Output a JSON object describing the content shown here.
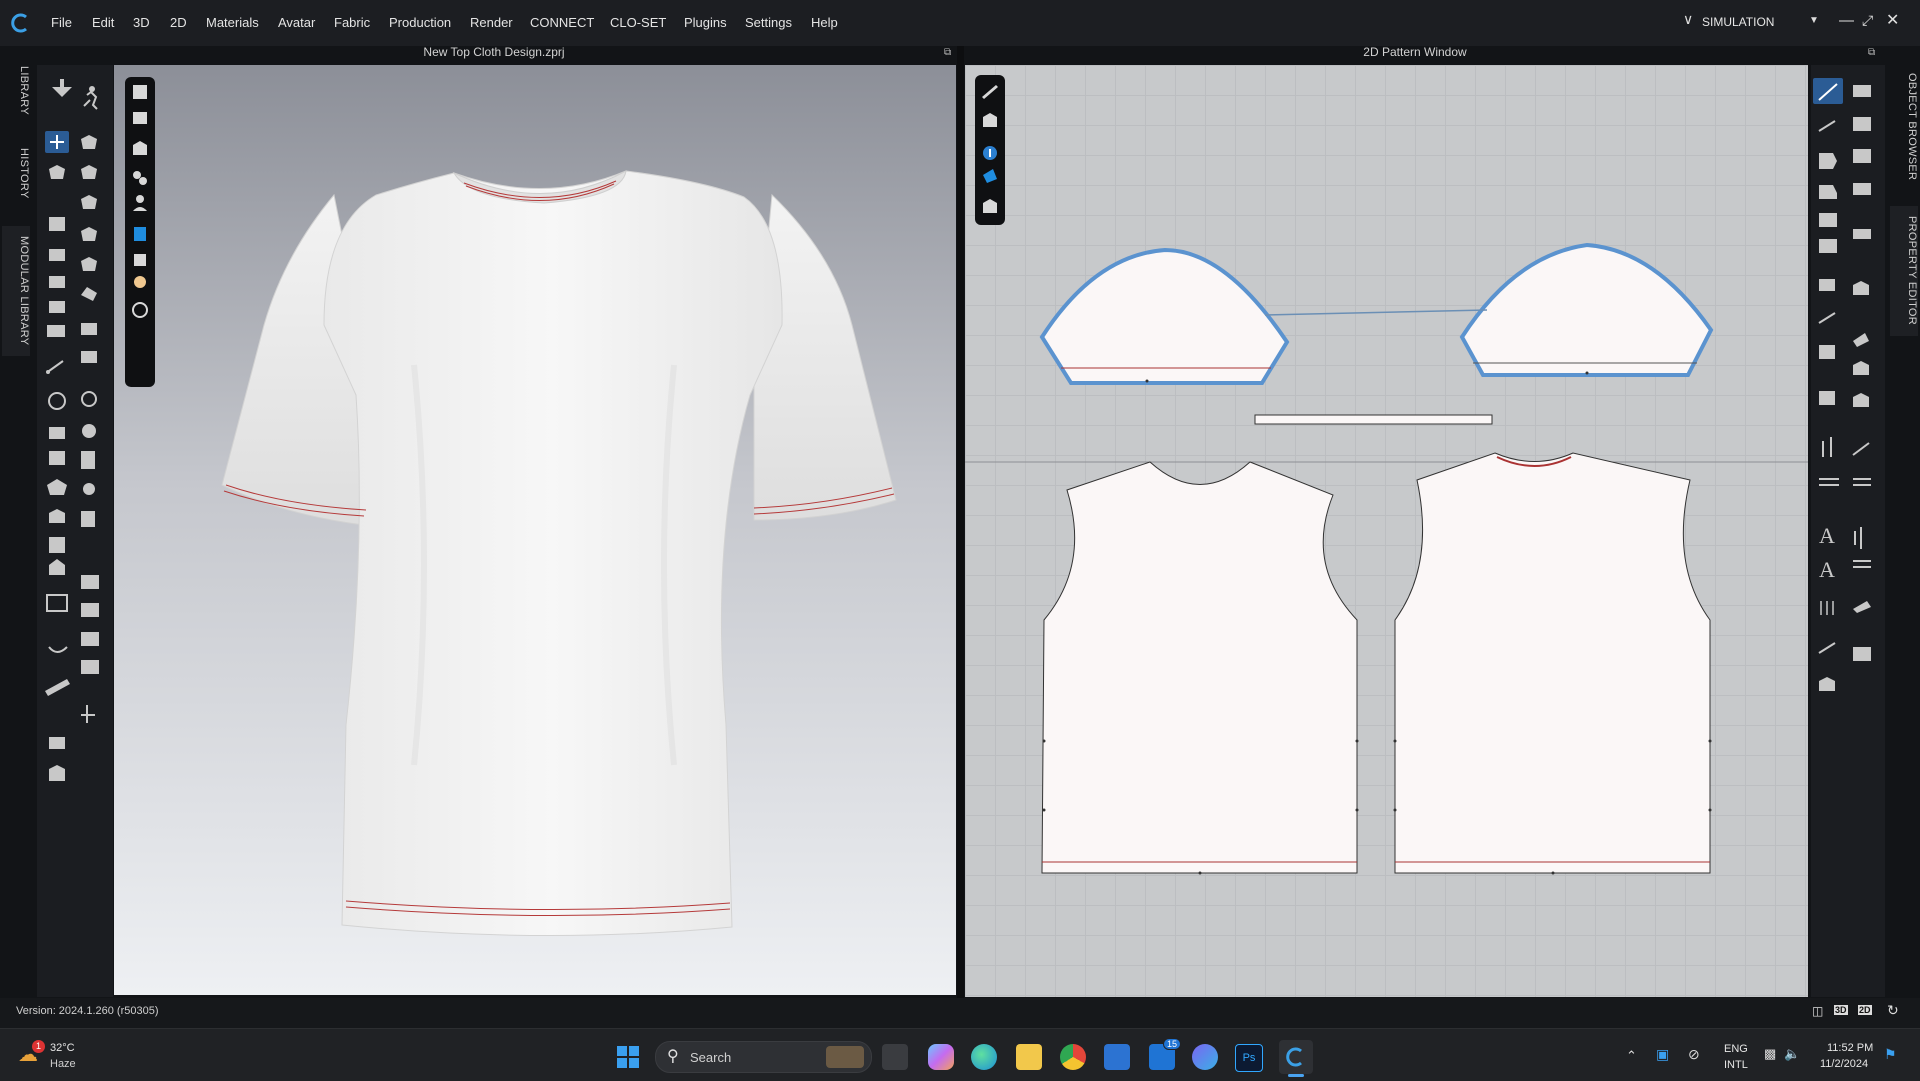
{
  "menu": {
    "items": [
      "File",
      "Edit",
      "3D",
      "2D",
      "Materials",
      "Avatar",
      "Fabric",
      "Production",
      "Render",
      "CONNECT",
      "CLO-SET",
      "Plugins",
      "Settings",
      "Help"
    ],
    "mode": "SIMULATION"
  },
  "left_tabs": [
    "LIBRARY",
    "HISTORY",
    "MODULAR LIBRARY"
  ],
  "right_tabs": [
    "OBJECT BROWSER",
    "PROPERTY EDITOR"
  ],
  "view3d": {
    "title": "New Top Cloth Design.zprj"
  },
  "view2d": {
    "title": "2D Pattern Window"
  },
  "status": {
    "version": "Version: 2024.1.260 (r50305)"
  },
  "taskbar": {
    "weather_temp": "32°C",
    "weather_desc": "Haze",
    "weather_badge": "1",
    "search_label": "Search",
    "mail_badge": "15",
    "lang_top": "ENG",
    "lang_bottom": "INTL",
    "time": "11:52 PM",
    "date": "11/2/2024"
  },
  "colors": {
    "accent": "#4a90d9",
    "pattern_fill": "#fbf7f7",
    "seam_red": "#a33",
    "selected_outline": "#5b93cf"
  }
}
